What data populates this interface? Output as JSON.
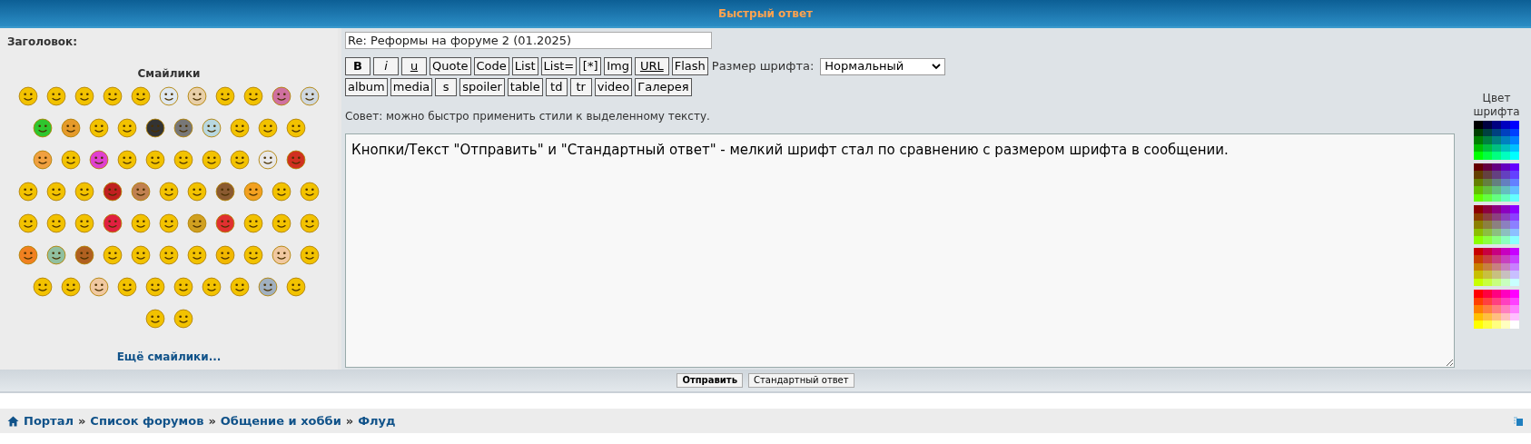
{
  "header": {
    "title": "Быстрый ответ"
  },
  "subject": {
    "label": "Заголовок:",
    "value": "Re: Реформы на форуме 2 (01.2025)"
  },
  "smilies": {
    "title": "Смайлики",
    "more_link": "Ещё смайлики..."
  },
  "toolbar": {
    "first_line": [
      {
        "label": "B",
        "kind": "bold"
      },
      {
        "label": "i",
        "kind": "italic"
      },
      {
        "label": "u",
        "kind": "underline"
      },
      {
        "label": "Quote",
        "kind": "plain"
      },
      {
        "label": "Code",
        "kind": "plain"
      },
      {
        "label": "List",
        "kind": "plain"
      },
      {
        "label": "List=",
        "kind": "plain"
      },
      {
        "label": "[*]",
        "kind": "plain"
      },
      {
        "label": "Img",
        "kind": "plain"
      },
      {
        "label": "URL",
        "kind": "link"
      },
      {
        "label": "Flash",
        "kind": "plain"
      }
    ],
    "second_line": [
      {
        "label": "album",
        "kind": "plain"
      },
      {
        "label": "media",
        "kind": "plain"
      },
      {
        "label": "s",
        "kind": "plain"
      },
      {
        "label": "spoiler",
        "kind": "plain"
      },
      {
        "label": "table",
        "kind": "plain"
      },
      {
        "label": "td",
        "kind": "plain"
      },
      {
        "label": "tr",
        "kind": "plain"
      },
      {
        "label": "video",
        "kind": "plain"
      },
      {
        "label": "Галерея",
        "kind": "plain"
      }
    ],
    "font_size": {
      "label": "Размер шрифта:",
      "value": "Нормальный"
    }
  },
  "hint": "Совет: можно быстро применить стили к выделенному тексту.",
  "message": {
    "value": "Кнопки/Текст \"Отправить\" и \"Стандартный ответ\" - мелкий шрифт стал по сравнению с размером шрифта в сообщении."
  },
  "color_panel": {
    "title": "Цвет шрифта"
  },
  "actions": [
    {
      "label": "Отправить",
      "kind": "primary"
    },
    {
      "label": "Стандартный ответ",
      "kind": "secondary"
    }
  ],
  "breadcrumbs": {
    "separator": "»",
    "items": [
      "Портал",
      "Список форумов",
      "Общение и хобби",
      "Флуд"
    ]
  }
}
